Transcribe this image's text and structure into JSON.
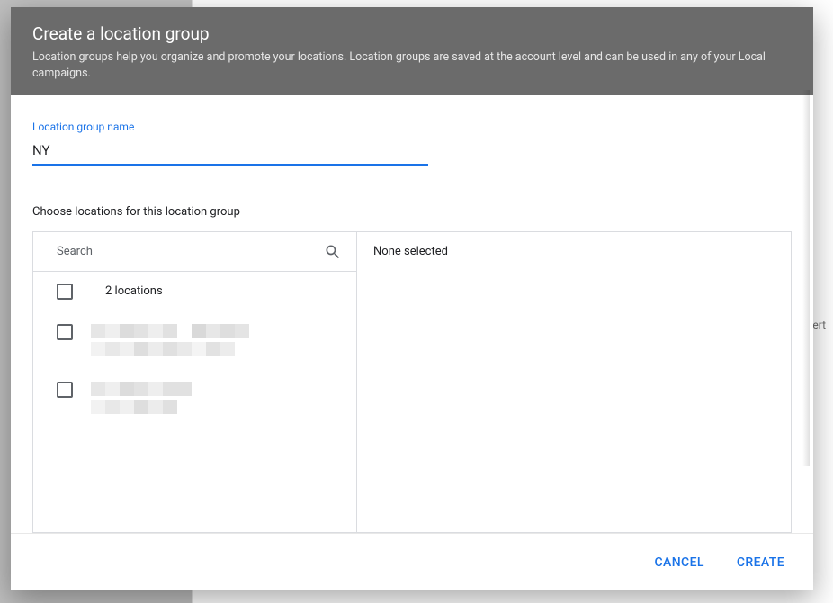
{
  "header": {
    "title": "Create a location group",
    "subtitle": "Location groups help you organize and promote your locations. Location groups are saved at the account level and can be used in any of your Local campaigns."
  },
  "form": {
    "name_label": "Location group name",
    "name_value": "NY",
    "choose_label": "Choose locations for this location group"
  },
  "search": {
    "placeholder": "Search"
  },
  "locations": {
    "count_label": "2 locations"
  },
  "selection": {
    "none_label": "None selected"
  },
  "footer": {
    "cancel": "CANCEL",
    "create": "CREATE"
  },
  "bg": {
    "snippet": "sert"
  }
}
